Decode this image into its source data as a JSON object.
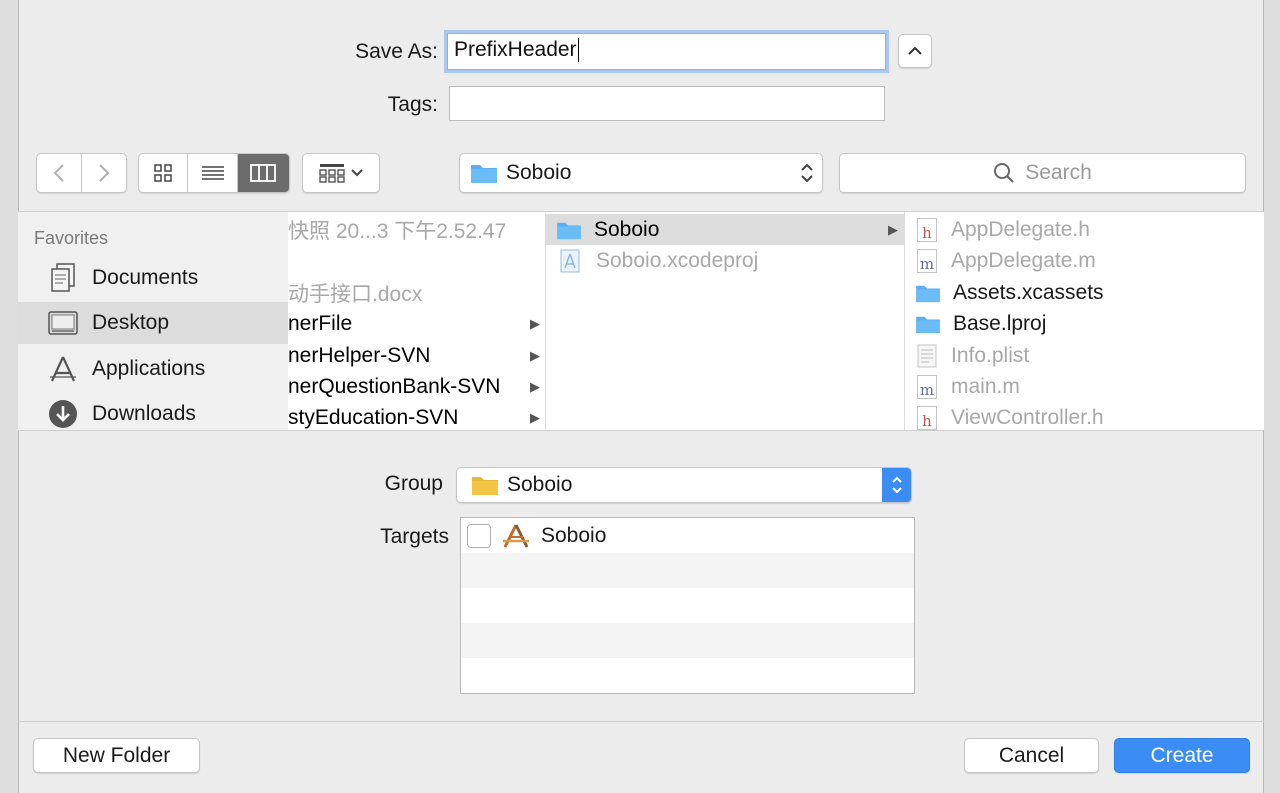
{
  "save_as": {
    "label": "Save As:",
    "value": "PrefixHeader"
  },
  "tags": {
    "label": "Tags:",
    "value": ""
  },
  "toolbar": {
    "location": "Soboio",
    "search_placeholder": "Search"
  },
  "sidebar": {
    "title": "Favorites",
    "items": [
      {
        "label": "Documents",
        "icon": "documents-icon"
      },
      {
        "label": "Desktop",
        "icon": "desktop-icon"
      },
      {
        "label": "Applications",
        "icon": "applications-icon"
      },
      {
        "label": "Downloads",
        "icon": "downloads-icon"
      }
    ]
  },
  "column1": {
    "items": [
      {
        "label": "快照 20...3 下午2.52.47"
      },
      {
        "label": ""
      },
      {
        "label": "动手接口.docx"
      },
      {
        "label": "nerFile"
      },
      {
        "label": "nerHelper-SVN"
      },
      {
        "label": "nerQuestionBank-SVN"
      },
      {
        "label": "styEducation-SVN"
      }
    ]
  },
  "column2": {
    "items": [
      {
        "label": "Soboio"
      },
      {
        "label": "Soboio.xcodeproj"
      }
    ]
  },
  "column3": {
    "items": [
      {
        "label": "AppDelegate.h",
        "badge": "h"
      },
      {
        "label": "AppDelegate.m",
        "badge": "m"
      },
      {
        "label": "Assets.xcassets"
      },
      {
        "label": "Base.lproj"
      },
      {
        "label": "Info.plist"
      },
      {
        "label": "main.m",
        "badge": "m"
      },
      {
        "label": "ViewController.h",
        "badge": "h"
      }
    ]
  },
  "group": {
    "label": "Group",
    "value": "Soboio"
  },
  "targets": {
    "label": "Targets",
    "items": [
      {
        "label": "Soboio",
        "checked": false
      }
    ]
  },
  "buttons": {
    "new_folder": "New Folder",
    "cancel": "Cancel",
    "create": "Create"
  },
  "colors": {
    "accent": "#3b8cf5",
    "folder_blue": "#5aaef2",
    "folder_yellow": "#f2c545"
  }
}
